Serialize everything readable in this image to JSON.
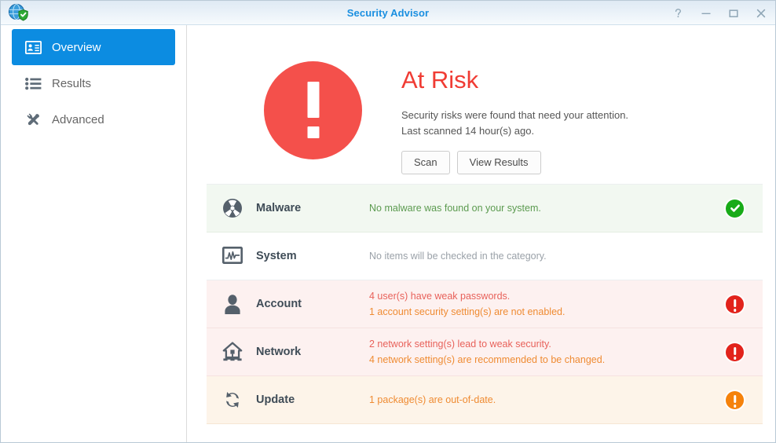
{
  "window": {
    "title": "Security Advisor",
    "logo_icon": "globe-shield-icon",
    "controls": [
      {
        "name": "help-button",
        "label": "?"
      },
      {
        "name": "minimize-button",
        "label": "—"
      },
      {
        "name": "maximize-button",
        "label": "□"
      },
      {
        "name": "close-button",
        "label": "✕"
      }
    ]
  },
  "sidebar": {
    "items": [
      {
        "label": "Overview",
        "icon": "id-card-icon",
        "active": true
      },
      {
        "label": "Results",
        "icon": "list-icon",
        "active": false
      },
      {
        "label": "Advanced",
        "icon": "tools-icon",
        "active": false
      }
    ]
  },
  "hero": {
    "status_icon": "exclamation-circle-icon",
    "status_color": "#f4504b",
    "title": "At Risk",
    "line1": "Security risks were found that need your attention.",
    "line2": "Last scanned 14 hour(s) ago.",
    "buttons": [
      {
        "name": "scan-button",
        "label": "Scan"
      },
      {
        "name": "view-results-button",
        "label": "View Results"
      }
    ]
  },
  "categories": [
    {
      "name": "malware",
      "title": "Malware",
      "icon": "radiation-icon",
      "state": "ok",
      "messages": [
        {
          "text": "No malware was found on your system.",
          "tone": "green"
        }
      ],
      "status_icon": "check-circle-icon",
      "status_color": "#18ab18"
    },
    {
      "name": "system",
      "title": "System",
      "icon": "monitor-graph-icon",
      "state": "neutral",
      "messages": [
        {
          "text": "No items will be checked in the category.",
          "tone": "gray"
        }
      ],
      "status_icon": "",
      "status_color": ""
    },
    {
      "name": "account",
      "title": "Account",
      "icon": "user-icon",
      "state": "risk",
      "messages": [
        {
          "text": "4 user(s) have weak passwords.",
          "tone": "red"
        },
        {
          "text": "1 account security setting(s) are not enabled.",
          "tone": "orange"
        }
      ],
      "status_icon": "alert-circle-icon",
      "status_color": "#e2231c"
    },
    {
      "name": "network",
      "title": "Network",
      "icon": "home-network-icon",
      "state": "risk",
      "messages": [
        {
          "text": "2 network setting(s) lead to weak security.",
          "tone": "red"
        },
        {
          "text": "4 network setting(s) are recommended to be changed.",
          "tone": "orange"
        }
      ],
      "status_icon": "alert-circle-icon",
      "status_color": "#e2231c"
    },
    {
      "name": "update",
      "title": "Update",
      "icon": "refresh-icon",
      "state": "warn",
      "messages": [
        {
          "text": "1 package(s) are out-of-date.",
          "tone": "orange"
        }
      ],
      "status_icon": "warn-circle-icon",
      "status_color": "#f5820b"
    }
  ]
}
